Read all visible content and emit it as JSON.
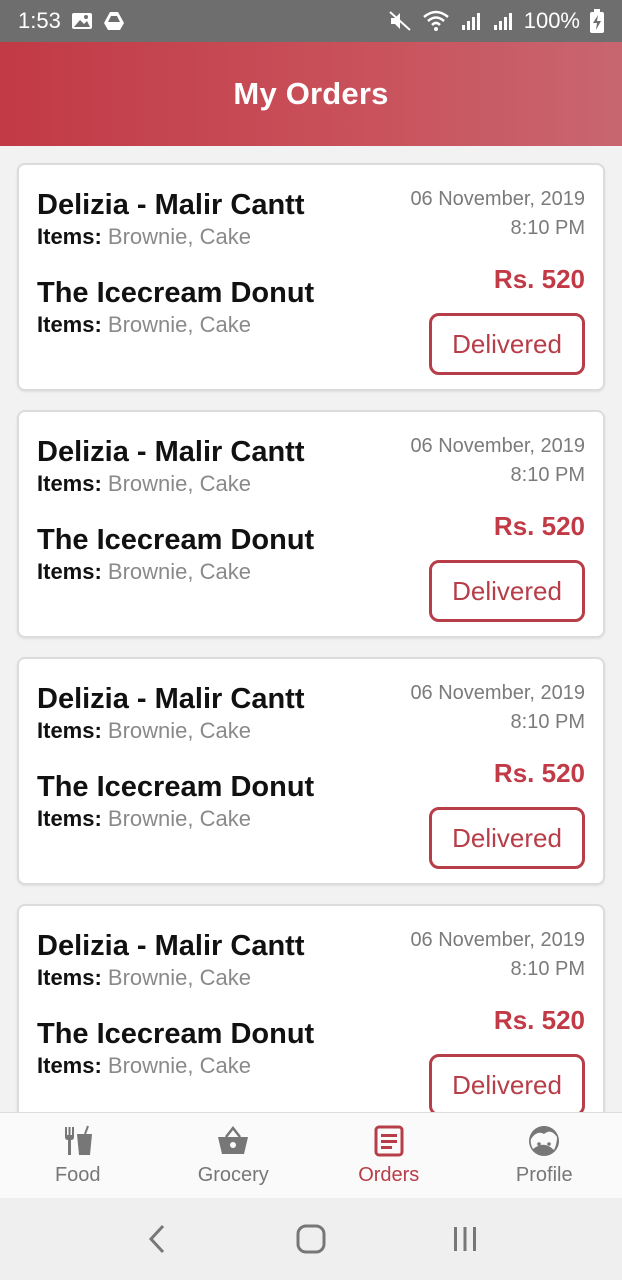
{
  "status_bar": {
    "time": "1:53",
    "battery": "100%"
  },
  "header": {
    "title": "My Orders"
  },
  "orders": [
    {
      "restaurants": [
        {
          "name": "Delizia - Malir Cantt",
          "items_label": "Items:",
          "items": "Brownie, Cake"
        },
        {
          "name": "The Icecream Donut",
          "items_label": "Items:",
          "items": "Brownie, Cake"
        }
      ],
      "date": "06 November, 2019",
      "time": "8:10 PM",
      "price": "Rs. 520",
      "status": "Delivered"
    },
    {
      "restaurants": [
        {
          "name": "Delizia - Malir Cantt",
          "items_label": "Items:",
          "items": "Brownie, Cake"
        },
        {
          "name": "The Icecream Donut",
          "items_label": "Items:",
          "items": "Brownie, Cake"
        }
      ],
      "date": "06 November, 2019",
      "time": "8:10 PM",
      "price": "Rs. 520",
      "status": "Delivered"
    },
    {
      "restaurants": [
        {
          "name": "Delizia - Malir Cantt",
          "items_label": "Items:",
          "items": "Brownie, Cake"
        },
        {
          "name": "The Icecream Donut",
          "items_label": "Items:",
          "items": "Brownie, Cake"
        }
      ],
      "date": "06 November, 2019",
      "time": "8:10 PM",
      "price": "Rs. 520",
      "status": "Delivered"
    },
    {
      "restaurants": [
        {
          "name": "Delizia - Malir Cantt",
          "items_label": "Items:",
          "items": "Brownie, Cake"
        },
        {
          "name": "The Icecream Donut",
          "items_label": "Items:",
          "items": "Brownie, Cake"
        }
      ],
      "date": "06 November, 2019",
      "time": "8:10 PM",
      "price": "Rs. 520",
      "status": "Delivered"
    }
  ],
  "bottom_nav": {
    "items": [
      {
        "label": "Food",
        "icon": "fork-knife-drink-icon"
      },
      {
        "label": "Grocery",
        "icon": "basket-icon"
      },
      {
        "label": "Orders",
        "icon": "receipt-icon"
      },
      {
        "label": "Profile",
        "icon": "face-icon"
      }
    ],
    "active": "Orders"
  },
  "colors": {
    "brand": "#c13a46",
    "status_bar": "#6e6e6e",
    "inactive_nav": "#777777"
  }
}
